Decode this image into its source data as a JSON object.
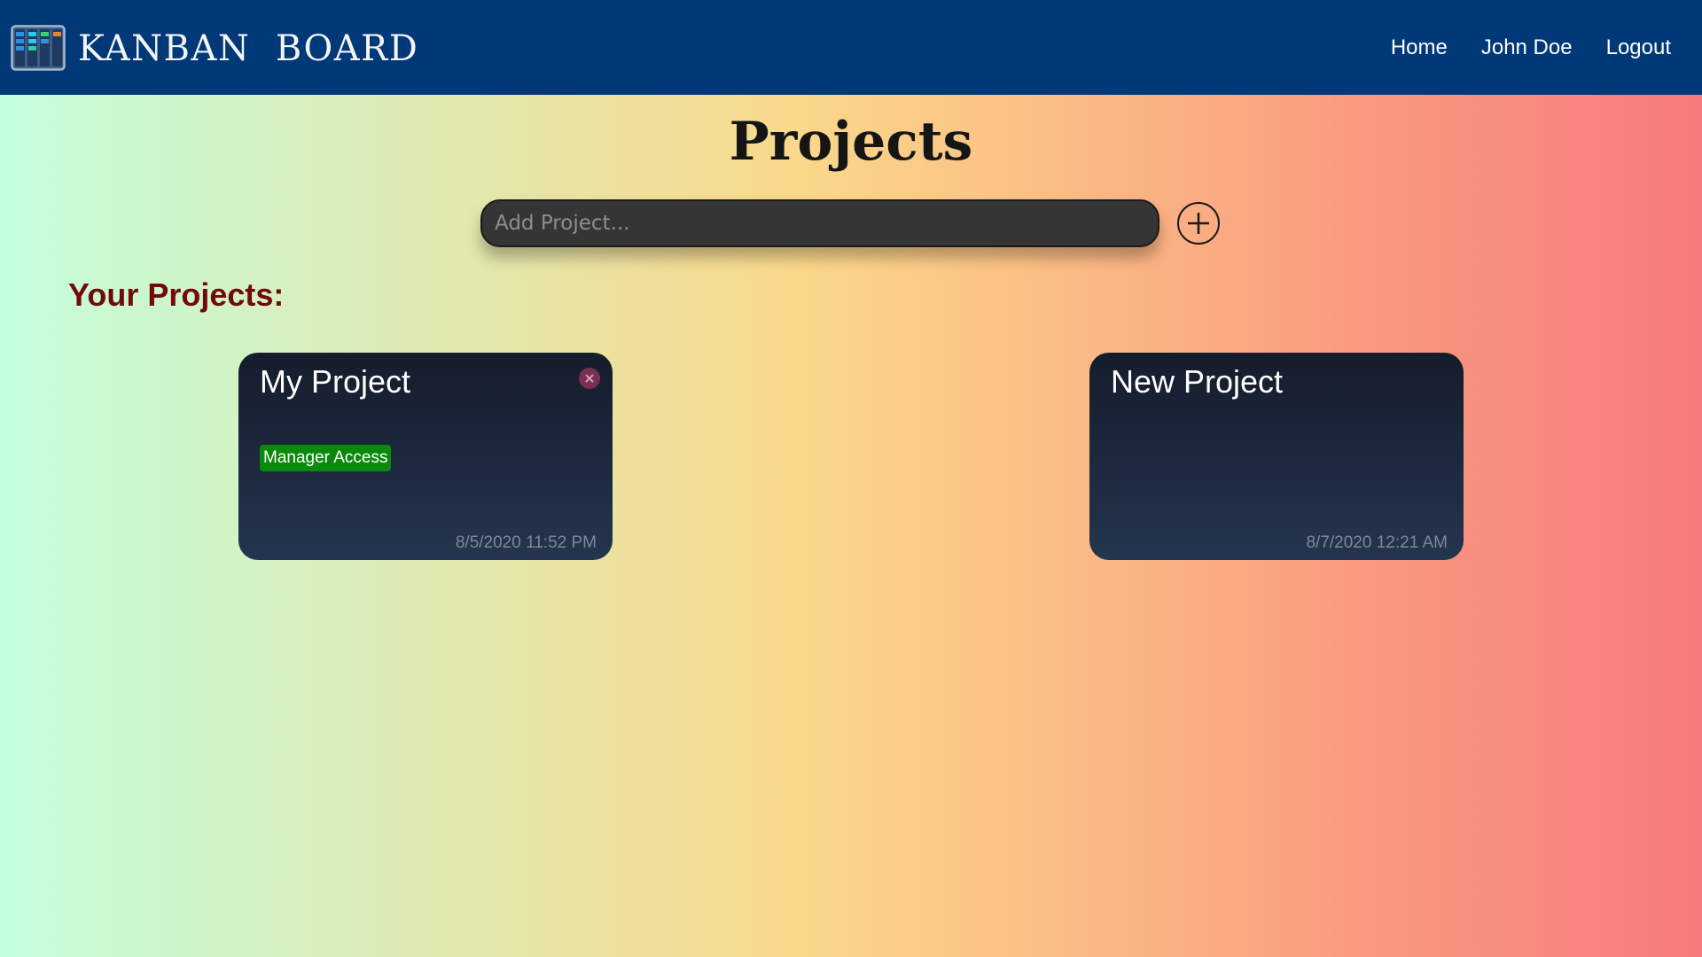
{
  "navbar": {
    "brand_title": "KANBAN  BOARD",
    "brand_icon": "kanban-board-icon",
    "links": [
      {
        "label": "Home"
      },
      {
        "label": "John Doe"
      },
      {
        "label": "Logout"
      }
    ],
    "background_color": "#003878"
  },
  "main": {
    "page_title": "Projects",
    "add_project": {
      "placeholder": "Add Project...",
      "value": "",
      "button_icon": "plus-circle-icon"
    },
    "section_heading": "Your Projects:"
  },
  "projects": [
    {
      "title": "My Project",
      "badge": "Manager Access",
      "date": "8/5/2020 11:52 PM",
      "has_delete": true,
      "delete_icon": "close-icon"
    },
    {
      "title": "New Project",
      "badge": "",
      "date": "8/7/2020 12:21 AM",
      "has_delete": false
    }
  ],
  "colors": {
    "section_heading": "#730a0a",
    "badge_background": "#0a8a0a",
    "card_background": "#1c2a40"
  }
}
